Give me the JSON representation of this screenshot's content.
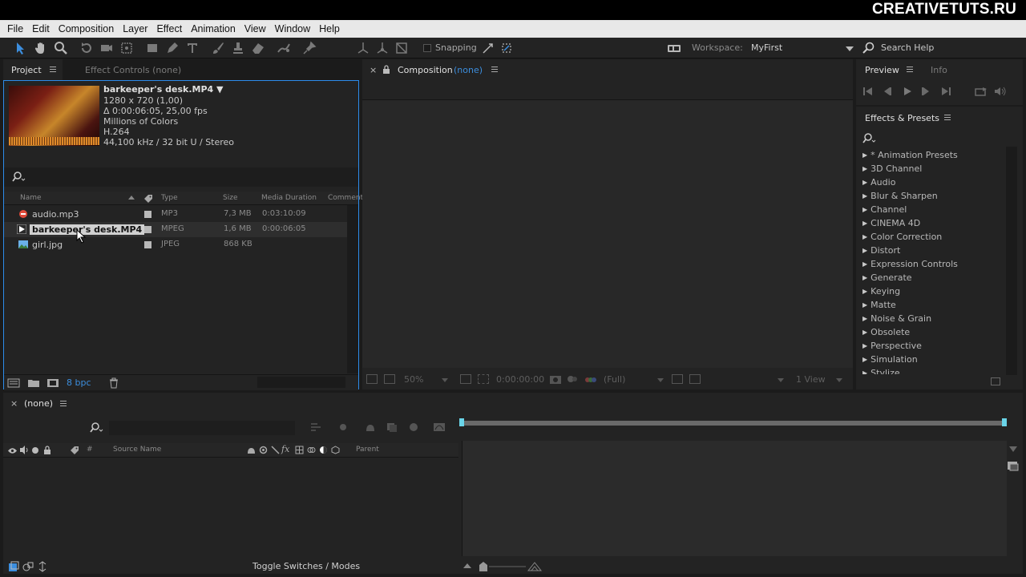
{
  "brand": "CREATIVETUTS.RU",
  "menu": [
    "File",
    "Edit",
    "Composition",
    "Layer",
    "Effect",
    "Animation",
    "View",
    "Window",
    "Help"
  ],
  "toolbar": {
    "snapping_label": "Snapping",
    "workspace_label": "Workspace:",
    "workspace_value": "MyFirst",
    "search_help": "Search Help"
  },
  "project": {
    "tab_project": "Project",
    "tab_effect_controls": "Effect Controls (none)",
    "selected_meta": {
      "name": "barkeeper's desk.MP4 ▼",
      "resolution": "1280 x 720 (1,00)",
      "duration": "Δ 0:00:06:05, 25,00 fps",
      "colors": "Millions of Colors",
      "codec": "H.264",
      "audio": "44,100 kHz / 32 bit U / Stereo"
    },
    "columns": {
      "name": "Name",
      "type": "Type",
      "size": "Size",
      "duration": "Media Duration",
      "comment": "Comment"
    },
    "files": [
      {
        "name": "audio.mp3",
        "type": "MP3",
        "size": "7,3 MB",
        "duration": "0:03:10:09"
      },
      {
        "name": "barkeeper's desk.MP4",
        "type": "MPEG",
        "size": "1,6 MB",
        "duration": "0:00:06:05"
      },
      {
        "name": "girl.jpg",
        "type": "JPEG",
        "size": "868 KB",
        "duration": ""
      }
    ],
    "bpc": "8 bpc"
  },
  "composition": {
    "tab_label": "Composition",
    "tab_value": "(none)",
    "zoom": "50%",
    "timecode": "0:00:00:00",
    "resolution": "(Full)",
    "views": "1 View"
  },
  "preview": {
    "tab_preview": "Preview",
    "tab_info": "Info"
  },
  "effects": {
    "title": "Effects & Presets",
    "items": [
      "* Animation Presets",
      "3D Channel",
      "Audio",
      "Blur & Sharpen",
      "Channel",
      "CINEMA 4D",
      "Color Correction",
      "Distort",
      "Expression Controls",
      "Generate",
      "Keying",
      "Matte",
      "Noise & Grain",
      "Obsolete",
      "Perspective",
      "Simulation",
      "Stylize"
    ]
  },
  "timeline": {
    "tab_label": "(none)",
    "col_hash": "#",
    "col_source_name": "Source Name",
    "col_parent": "Parent",
    "toggle_modes": "Toggle Switches / Modes"
  },
  "colors": {
    "accent_blue": "#2d8ceb",
    "bpc_blue": "#3c8ede",
    "selection": "#d0d0d0"
  }
}
